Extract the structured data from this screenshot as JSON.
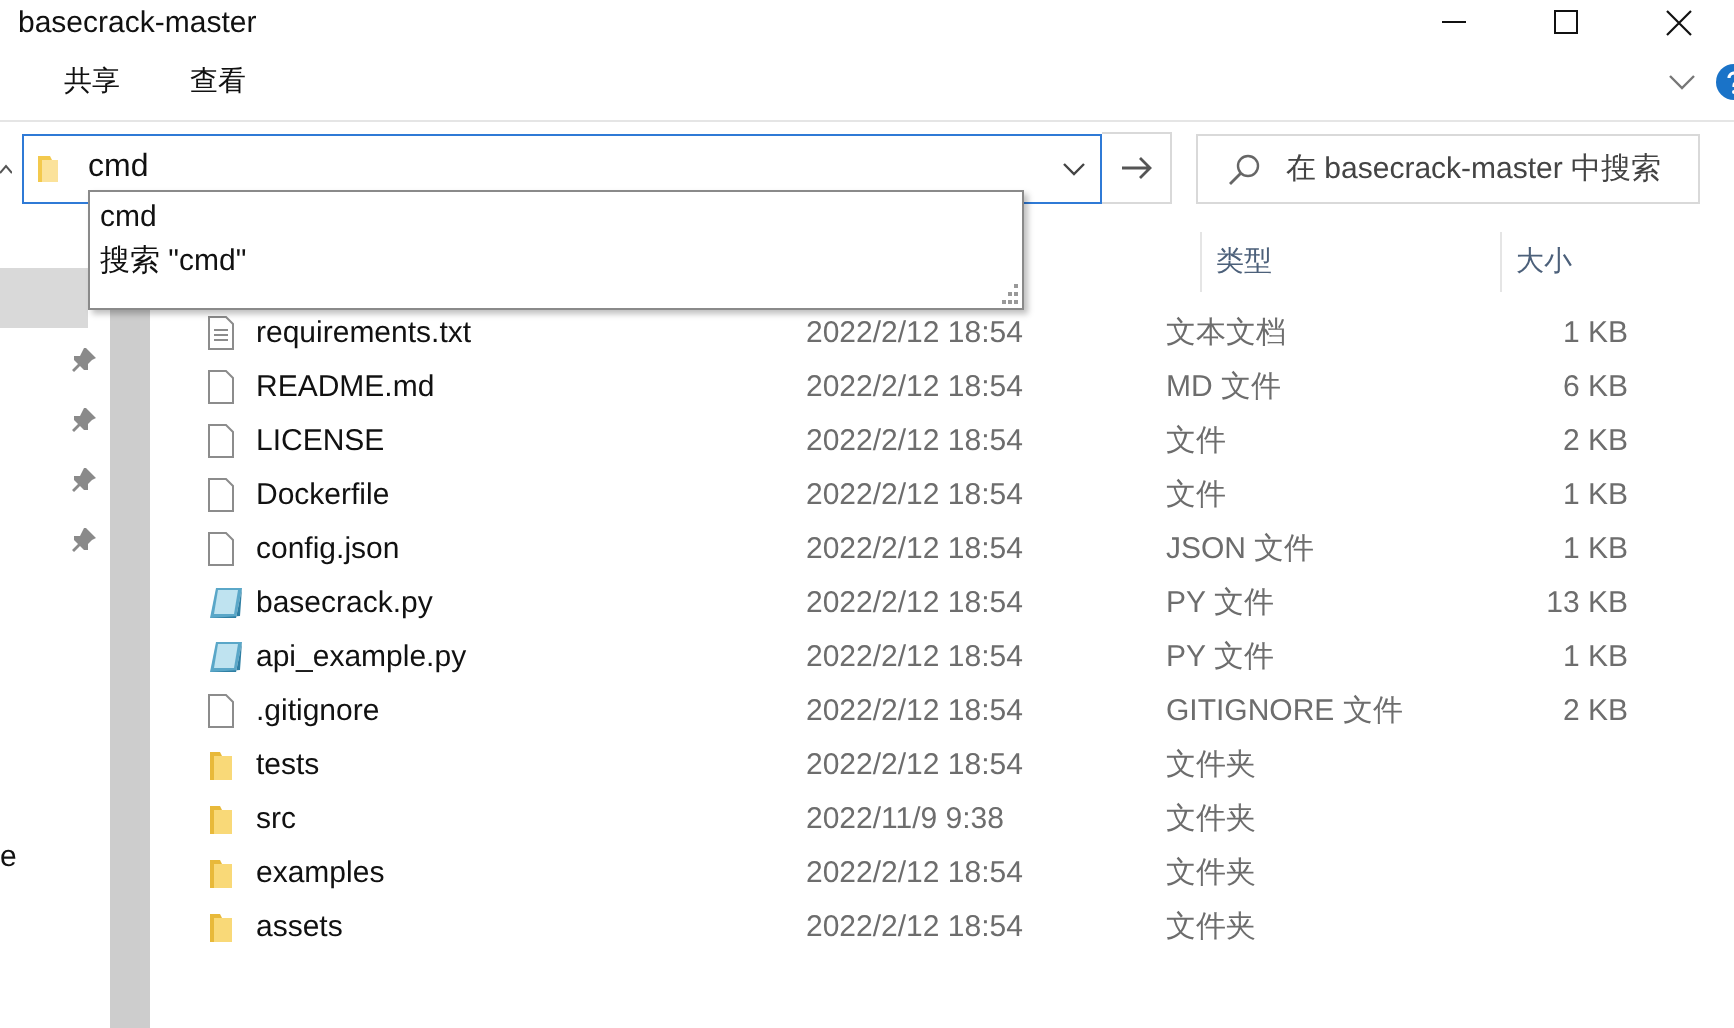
{
  "window": {
    "title": "basecrack-master"
  },
  "ribbon_tabs": [
    {
      "label": "共享"
    },
    {
      "label": "查看"
    }
  ],
  "address_bar": {
    "value": "cmd"
  },
  "autocomplete": [
    {
      "label": "cmd",
      "selected": false
    },
    {
      "label": "搜索 \"cmd\"",
      "selected": false
    }
  ],
  "search": {
    "placeholder": "在 basecrack-master 中搜索"
  },
  "sidebar": {
    "quick_access": [
      {
        "selected": true,
        "pinned": false
      },
      {
        "selected": false,
        "pinned": true
      },
      {
        "selected": false,
        "pinned": true
      },
      {
        "selected": false,
        "pinned": true
      },
      {
        "selected": false,
        "pinned": true
      }
    ],
    "items": [
      {
        "label": "e"
      }
    ]
  },
  "table": {
    "columns": [
      "类型",
      "大小"
    ],
    "rows": [
      {
        "kind": "text",
        "name": "requirements.txt",
        "date": "2022/2/12 18:54",
        "type": "文本文档",
        "size": "1 KB"
      },
      {
        "kind": "file",
        "name": "README.md",
        "date": "2022/2/12 18:54",
        "type": "MD 文件",
        "size": "6 KB"
      },
      {
        "kind": "file",
        "name": "LICENSE",
        "date": "2022/2/12 18:54",
        "type": "文件",
        "size": "2 KB"
      },
      {
        "kind": "file",
        "name": "Dockerfile",
        "date": "2022/2/12 18:54",
        "type": "文件",
        "size": "1 KB"
      },
      {
        "kind": "file",
        "name": "config.json",
        "date": "2022/2/12 18:54",
        "type": "JSON 文件",
        "size": "1 KB"
      },
      {
        "kind": "python",
        "name": "basecrack.py",
        "date": "2022/2/12 18:54",
        "type": "PY 文件",
        "size": "13 KB"
      },
      {
        "kind": "python",
        "name": "api_example.py",
        "date": "2022/2/12 18:54",
        "type": "PY 文件",
        "size": "1 KB"
      },
      {
        "kind": "file",
        "name": ".gitignore",
        "date": "2022/2/12 18:54",
        "type": "GITIGNORE 文件",
        "size": "2 KB"
      },
      {
        "kind": "folder",
        "name": "tests",
        "date": "2022/2/12 18:54",
        "type": "文件夹"
      },
      {
        "kind": "folder",
        "name": "src",
        "date": "2022/11/9 9:38",
        "type": "文件夹"
      },
      {
        "kind": "folder",
        "name": "examples",
        "date": "2022/2/12 18:54",
        "type": "文件夹"
      },
      {
        "kind": "folder",
        "name": "assets",
        "date": "2022/2/12 18:54",
        "type": "文件夹"
      }
    ]
  }
}
